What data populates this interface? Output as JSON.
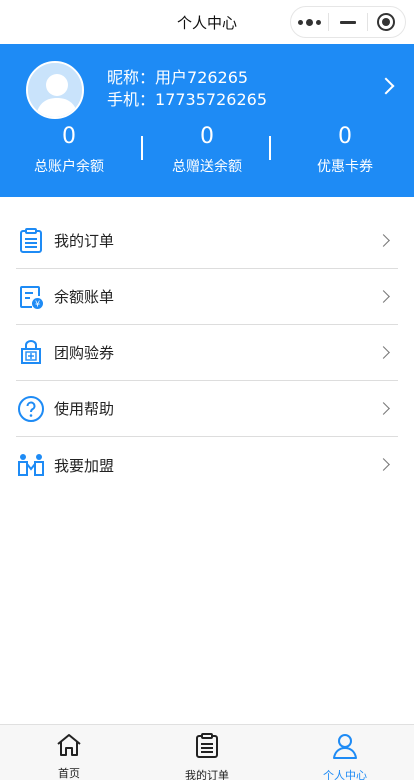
{
  "navbar": {
    "title": "个人中心"
  },
  "profile": {
    "nickname_label": "昵称：",
    "nickname": "用户726265",
    "phone_label": "手机：",
    "phone": "17735726265"
  },
  "stats": [
    {
      "value": "0",
      "label": "总账户余额"
    },
    {
      "value": "0",
      "label": "总赠送余额"
    },
    {
      "value": "0",
      "label": "优惠卡券"
    }
  ],
  "menu": [
    {
      "label": "我的订单",
      "icon": "order-list-icon"
    },
    {
      "label": "余额账单",
      "icon": "balance-bill-icon"
    },
    {
      "label": "团购验券",
      "icon": "group-coupon-icon"
    },
    {
      "label": "使用帮助",
      "icon": "help-icon"
    },
    {
      "label": "我要加盟",
      "icon": "join-icon"
    }
  ],
  "tabbar": [
    {
      "label": "首页",
      "icon": "home-icon",
      "active": false
    },
    {
      "label": "我的订单",
      "icon": "order-icon",
      "active": false
    },
    {
      "label": "个人中心",
      "icon": "person-icon",
      "active": true
    }
  ],
  "colors": {
    "brand": "#1e8bf5",
    "divider": "#dddddd",
    "tabbar_bg": "#f7f7f7"
  }
}
